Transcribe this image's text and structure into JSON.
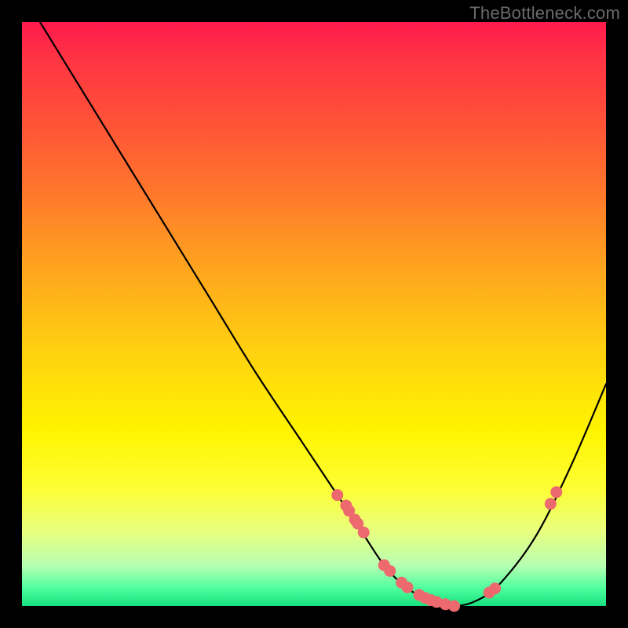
{
  "watermark": "TheBottleneck.com",
  "chart_data": {
    "type": "line",
    "title": "",
    "xlabel": "",
    "ylabel": "",
    "xlim": [
      0,
      100
    ],
    "ylim": [
      0,
      100
    ],
    "grid": false,
    "series": [
      {
        "name": "bottleneck-curve",
        "x": [
          0,
          8,
          16,
          24,
          32,
          40,
          48,
          54,
          58,
          62,
          66,
          70,
          74,
          78,
          82,
          88,
          94,
          100
        ],
        "y": [
          105,
          92,
          79,
          66,
          53,
          40,
          28,
          19,
          13,
          7,
          3,
          1,
          0,
          1,
          4,
          12,
          24,
          38
        ]
      }
    ],
    "markers": {
      "name": "highlighted-points",
      "color": "#ec6a6e",
      "x": [
        54,
        55.5,
        56,
        57,
        57.5,
        58.5,
        62,
        63,
        65,
        66,
        68,
        69,
        70,
        71,
        72.5,
        74,
        80,
        81,
        90.5,
        91.5
      ],
      "y": [
        19,
        17.2,
        16.3,
        14.8,
        14.1,
        12.6,
        7,
        6,
        4,
        3.2,
        1.9,
        1.4,
        1,
        0.7,
        0.3,
        0,
        2.3,
        3.0,
        17.5,
        19.5
      ]
    }
  }
}
